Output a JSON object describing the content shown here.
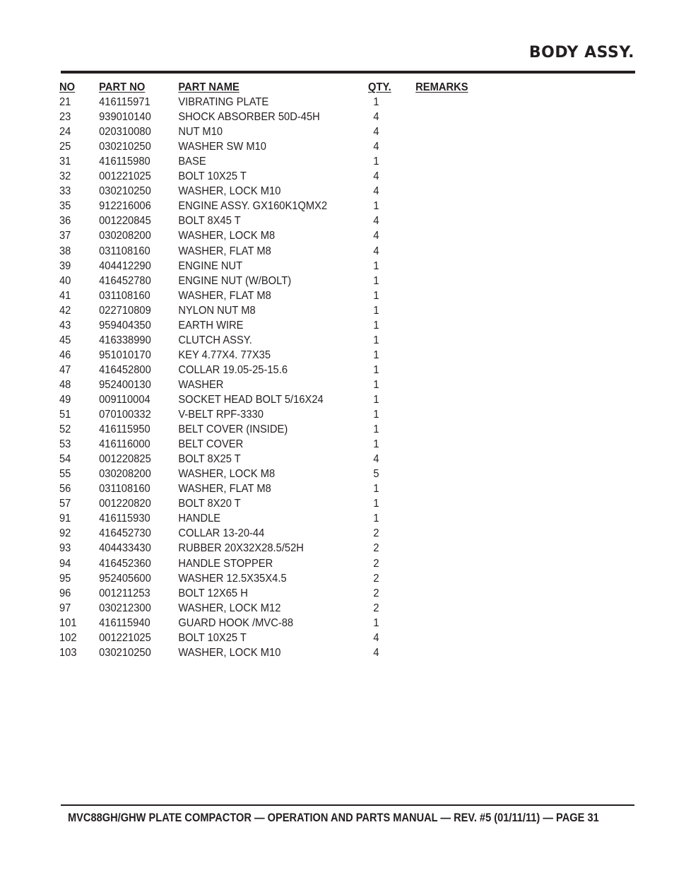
{
  "page": {
    "title": "BODY ASSY.",
    "footer": "MVC88GH/GHW PLATE COMPACTOR  — OPERATION AND PARTS MANUAL —  REV. #5 (01/11/11) — PAGE 31"
  },
  "table": {
    "headers": {
      "no": "NO",
      "part_no": "PART NO",
      "part_name": "PART NAME",
      "qty": "QTY.",
      "remarks": "REMARKS"
    },
    "rows": [
      {
        "no": "21",
        "part_no": "416115971",
        "part_name": "VIBRATING PLATE",
        "qty": "1",
        "remarks": ""
      },
      {
        "no": "23",
        "part_no": "939010140",
        "part_name": "SHOCK ABSORBER 50D-45H",
        "qty": "4",
        "remarks": ""
      },
      {
        "no": "24",
        "part_no": "020310080",
        "part_name": "NUT M10",
        "qty": "4",
        "remarks": ""
      },
      {
        "no": "25",
        "part_no": "030210250",
        "part_name": "WASHER SW M10",
        "qty": "4",
        "remarks": ""
      },
      {
        "no": "31",
        "part_no": "416115980",
        "part_name": "BASE",
        "qty": "1",
        "remarks": ""
      },
      {
        "no": "32",
        "part_no": "001221025",
        "part_name": "BOLT 10X25 T",
        "qty": "4",
        "remarks": ""
      },
      {
        "no": "33",
        "part_no": "030210250",
        "part_name": "WASHER, LOCK M10",
        "qty": "4",
        "remarks": ""
      },
      {
        "no": "35",
        "part_no": "912216006",
        "part_name": "ENGINE ASSY. GX160K1QMX2",
        "qty": "1",
        "remarks": ""
      },
      {
        "no": "36",
        "part_no": "001220845",
        "part_name": "BOLT 8X45 T",
        "qty": "4",
        "remarks": ""
      },
      {
        "no": "37",
        "part_no": "030208200",
        "part_name": "WASHER, LOCK M8",
        "qty": "4",
        "remarks": ""
      },
      {
        "no": "38",
        "part_no": "031108160",
        "part_name": "WASHER, FLAT M8",
        "qty": "4",
        "remarks": ""
      },
      {
        "no": "39",
        "part_no": "404412290",
        "part_name": "ENGINE NUT",
        "qty": "1",
        "remarks": ""
      },
      {
        "no": "40",
        "part_no": "416452780",
        "part_name": "ENGINE NUT (W/BOLT)",
        "qty": "1",
        "remarks": ""
      },
      {
        "no": "41",
        "part_no": "031108160",
        "part_name": "WASHER, FLAT M8",
        "qty": "1",
        "remarks": ""
      },
      {
        "no": "42",
        "part_no": "022710809",
        "part_name": "NYLON NUT M8",
        "qty": "1",
        "remarks": ""
      },
      {
        "no": "43",
        "part_no": "959404350",
        "part_name": "EARTH WIRE",
        "qty": "1",
        "remarks": ""
      },
      {
        "no": "45",
        "part_no": "416338990",
        "part_name": "CLUTCH ASSY.",
        "qty": "1",
        "remarks": ""
      },
      {
        "no": "46",
        "part_no": "951010170",
        "part_name": "KEY 4.77X4. 77X35",
        "qty": "1",
        "remarks": ""
      },
      {
        "no": "47",
        "part_no": "416452800",
        "part_name": "COLLAR 19.05-25-15.6",
        "qty": "1",
        "remarks": ""
      },
      {
        "no": "48",
        "part_no": "952400130",
        "part_name": "WASHER",
        "qty": "1",
        "remarks": ""
      },
      {
        "no": "49",
        "part_no": "009110004",
        "part_name": "SOCKET HEAD BOLT 5/16X24",
        "qty": "1",
        "remarks": ""
      },
      {
        "no": "51",
        "part_no": "070100332",
        "part_name": "V-BELT RPF-3330",
        "qty": "1",
        "remarks": ""
      },
      {
        "no": "52",
        "part_no": "416115950",
        "part_name": "BELT COVER (INSIDE)",
        "qty": "1",
        "remarks": ""
      },
      {
        "no": "53",
        "part_no": "416116000",
        "part_name": "BELT COVER",
        "qty": "1",
        "remarks": ""
      },
      {
        "no": "54",
        "part_no": "001220825",
        "part_name": "BOLT 8X25 T",
        "qty": "4",
        "remarks": ""
      },
      {
        "no": "55",
        "part_no": "030208200",
        "part_name": "WASHER, LOCK M8",
        "qty": "5",
        "remarks": ""
      },
      {
        "no": "56",
        "part_no": "031108160",
        "part_name": "WASHER, FLAT M8",
        "qty": "1",
        "remarks": ""
      },
      {
        "no": "57",
        "part_no": "001220820",
        "part_name": "BOLT 8X20 T",
        "qty": "1",
        "remarks": ""
      },
      {
        "no": "91",
        "part_no": "416115930",
        "part_name": "HANDLE",
        "qty": "1",
        "remarks": ""
      },
      {
        "no": "92",
        "part_no": "416452730",
        "part_name": "COLLAR 13-20-44",
        "qty": "2",
        "remarks": ""
      },
      {
        "no": "93",
        "part_no": "404433430",
        "part_name": "RUBBER 20X32X28.5/52H",
        "qty": "2",
        "remarks": ""
      },
      {
        "no": "94",
        "part_no": "416452360",
        "part_name": "HANDLE STOPPER",
        "qty": "2",
        "remarks": ""
      },
      {
        "no": "95",
        "part_no": "952405600",
        "part_name": "WASHER 12.5X35X4.5",
        "qty": "2",
        "remarks": ""
      },
      {
        "no": "96",
        "part_no": "001211253",
        "part_name": "BOLT 12X65 H",
        "qty": "2",
        "remarks": ""
      },
      {
        "no": "97",
        "part_no": "030212300",
        "part_name": "WASHER, LOCK M12",
        "qty": "2",
        "remarks": ""
      },
      {
        "no": "101",
        "part_no": "416115940",
        "part_name": "GUARD HOOK /MVC-88",
        "qty": "1",
        "remarks": ""
      },
      {
        "no": "102",
        "part_no": "001221025",
        "part_name": "BOLT 10X25 T",
        "qty": "4",
        "remarks": ""
      },
      {
        "no": "103",
        "part_no": "030210250",
        "part_name": "WASHER, LOCK M10",
        "qty": "4",
        "remarks": ""
      }
    ]
  }
}
